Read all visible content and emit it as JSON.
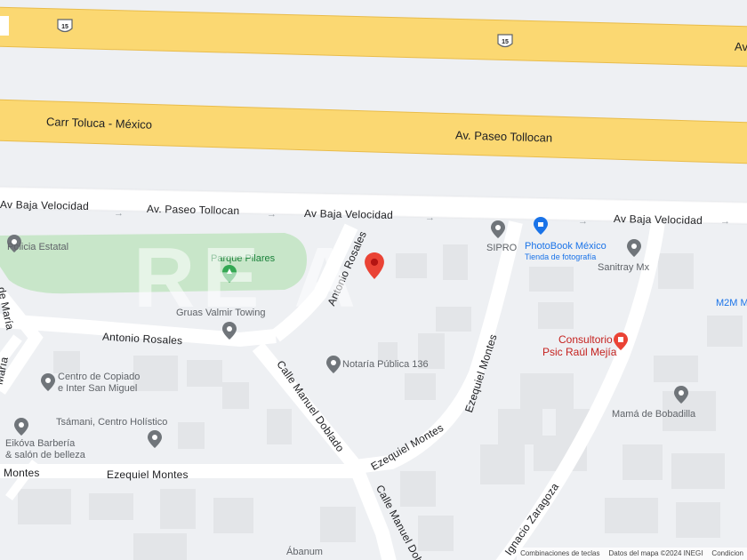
{
  "map": {
    "shield_number": "15",
    "highways": {
      "top_label_right": "Av",
      "carr_toluca": "Carr Toluca - México",
      "paseo_tollocan_main": "Av. Paseo Tollocan"
    },
    "roads": {
      "baja_velocidad_left": "Av Baja Velocidad",
      "paseo_tollocan_lateral": "Av. Paseo Tollocan",
      "baja_velocidad_mid": "Av Baja Velocidad",
      "baja_velocidad_right": "Av Baja Velocidad",
      "antonio_rosales_h": "Antonio Rosales",
      "antonio_rosales_v": "Antonio Rosales",
      "manuel_doblado_1": "Calle Manuel Doblado",
      "manuel_doblado_2": "Calle Manuel Dob",
      "ezequiel_montes_1": "Ezequiel Montes",
      "ezequiel_montes_2": "Ezequiel Montes",
      "ezequiel_montes_h": "Ezequiel Montes",
      "ezequiel_montes_left": "Montes",
      "ignacio_zaragoza": "Ignacio Zaragoza",
      "maria_1": "de María",
      "maria_2": "María"
    },
    "pois": {
      "policia": "Policia Estatal",
      "parque": "Parque Pilares",
      "gruas": "Gruas Valmir Towing",
      "sipro": "SIPRO",
      "photobook": "PhotoBook México",
      "photobook_sub": "Tienda de fotografía",
      "sanitray": "Sanitray Mx",
      "m2m": "M2M M",
      "consultorio_1": "Consultorio",
      "consultorio_2": "Psic Raúl Mejía",
      "notaria": "Notaría Pública 136",
      "copiado_1": "Centro de Copiado",
      "copiado_2": "e Inter San Miguel",
      "tsamani": "Tsámani, Centro Holístico",
      "eikova_1": "Eikóva Barbería",
      "eikova_2": "& salón de belleza",
      "mama": "Mamá de Bobadilla",
      "abanum": "Ábanum"
    },
    "watermark": "RE A",
    "footer": {
      "shortcuts": "Combinaciones de teclas",
      "data": "Datos del mapa ©2024 INEGI",
      "conditions": "Condicion"
    },
    "colors": {
      "highway": "#fbd872",
      "highway_edge": "#e9bc4a",
      "road": "#ffffff",
      "park": "#c8e6c9",
      "building": "#e3e5e8",
      "pin_red": "#ea4335",
      "pin_gray": "#70757a",
      "pin_blue": "#1a73e8"
    }
  }
}
